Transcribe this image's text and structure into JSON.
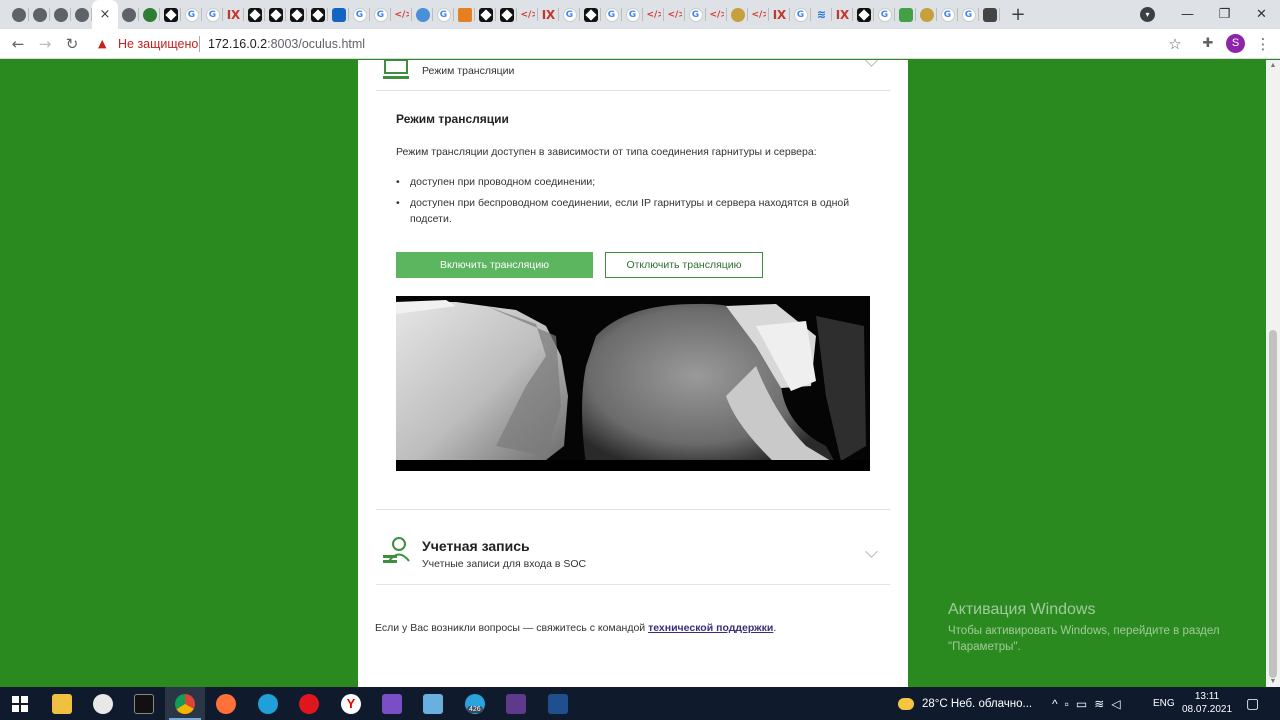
{
  "browser": {
    "tabs": [
      {
        "icon": "globe"
      },
      {
        "icon": "globe"
      },
      {
        "icon": "globe"
      },
      {
        "icon": "globe"
      },
      {
        "icon": "active",
        "close": "×"
      },
      {
        "icon": "globe"
      },
      {
        "icon": "green"
      },
      {
        "icon": "box"
      },
      {
        "icon": "google"
      },
      {
        "icon": "google"
      },
      {
        "icon": "tower"
      },
      {
        "icon": "box"
      },
      {
        "icon": "box"
      },
      {
        "icon": "box"
      },
      {
        "icon": "box"
      },
      {
        "icon": "blueg"
      },
      {
        "icon": "google"
      },
      {
        "icon": "google"
      },
      {
        "icon": "code"
      },
      {
        "icon": "cloud"
      },
      {
        "icon": "google"
      },
      {
        "icon": "mark"
      },
      {
        "icon": "box"
      },
      {
        "icon": "box"
      },
      {
        "icon": "code"
      },
      {
        "icon": "tower"
      },
      {
        "icon": "google"
      },
      {
        "icon": "box"
      },
      {
        "icon": "google"
      },
      {
        "icon": "google"
      },
      {
        "icon": "code"
      },
      {
        "icon": "code"
      },
      {
        "icon": "google"
      },
      {
        "icon": "code"
      },
      {
        "icon": "snake"
      },
      {
        "icon": "code"
      },
      {
        "icon": "tower"
      },
      {
        "icon": "google"
      },
      {
        "icon": "wave"
      },
      {
        "icon": "tower"
      },
      {
        "icon": "box"
      },
      {
        "icon": "google"
      },
      {
        "icon": "leaf"
      },
      {
        "icon": "snake"
      },
      {
        "icon": "google"
      },
      {
        "icon": "google"
      },
      {
        "icon": "dark"
      }
    ],
    "new_tab": "+",
    "insecure_label": "Не защищено",
    "url_host": "172.16.0.2",
    "url_rest": ":8003/oculus.html",
    "profile_initial": "S"
  },
  "page": {
    "top_section": {
      "subtitle": "Режим трансляции"
    },
    "content": {
      "title": "Режим трансляции",
      "intro": "Режим трансляции доступен в зависимости от типа соединения гарнитуры и сервера:",
      "bullets": [
        "доступен при проводном соединении;",
        "доступен при беспроводном соединении, если IP гарнитуры и сервера находятся в одной подсети."
      ],
      "enable_button": "Включить трансляцию",
      "disable_button": "Отключить трансляцию"
    },
    "account_section": {
      "title": "Учетная запись",
      "subtitle": "Учетные записи для входа в SOC"
    },
    "footer": {
      "text": "Если у Вас возникли вопросы — свяжитесь с командой ",
      "link": "технической поддержки",
      "after": "."
    }
  },
  "windows_activation": {
    "title": "Активация Windows",
    "line1": "Чтобы активировать Windows, перейдите в раздел",
    "line2": "\"Параметры\"."
  },
  "taskbar": {
    "weather": "28°C  Неб. облачно...",
    "lang": "ENG",
    "time": "13:11",
    "date": "08.07.2021",
    "telegram_badge": "426"
  }
}
